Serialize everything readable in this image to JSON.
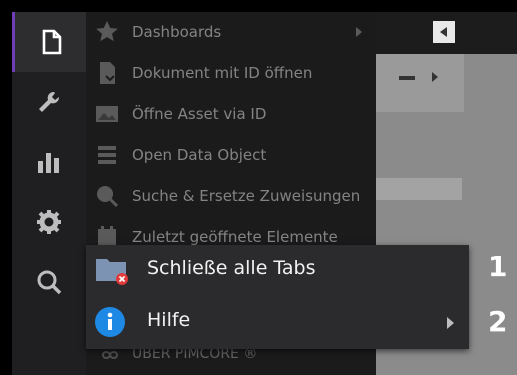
{
  "sidebar": {
    "items": [
      {
        "icon": "document-icon"
      },
      {
        "icon": "wrench-icon"
      },
      {
        "icon": "chart-bars-icon"
      },
      {
        "icon": "gear-icon"
      },
      {
        "icon": "search-icon"
      }
    ],
    "accent": "#6f3fb7"
  },
  "menu": {
    "items": [
      {
        "label": "Dashboards",
        "icon": "star-icon",
        "has_submenu": true
      },
      {
        "label": "Dokument mit ID öffnen",
        "icon": "document-open-icon"
      },
      {
        "label": "Öffne Asset via ID",
        "icon": "image-asset-icon"
      },
      {
        "label": "Open Data Object",
        "icon": "data-object-icon"
      },
      {
        "label": "Suche & Ersetze Zuweisungen",
        "icon": "search-replace-icon"
      },
      {
        "label": "Zuletzt geöffnete Elemente",
        "icon": "calendar-icon"
      }
    ],
    "footer_label": "ÜBER PIMCORE ®"
  },
  "popup": {
    "items": [
      {
        "label": "Schließe alle Tabs",
        "icon": "folder-close-icon",
        "callout": "1"
      },
      {
        "label": "Hilfe",
        "icon": "info-icon",
        "has_submenu": true,
        "callout": "2"
      }
    ]
  }
}
